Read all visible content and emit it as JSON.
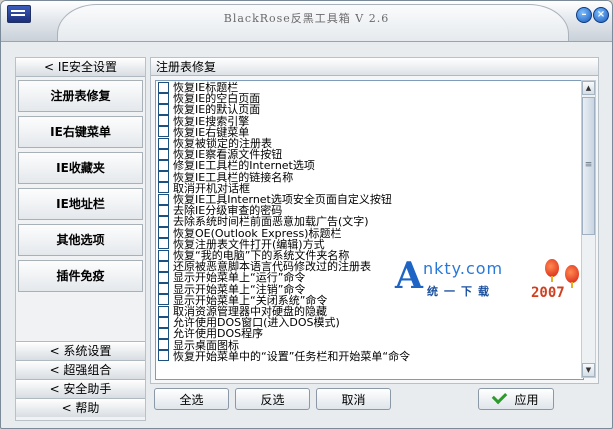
{
  "window": {
    "title": "BlackRose反黑工具箱 V 2.6"
  },
  "sidebar": {
    "header": "<  IE安全设置",
    "items": [
      {
        "label": "注册表修复"
      },
      {
        "label": "IE右键菜单"
      },
      {
        "label": "IE收藏夹"
      },
      {
        "label": "IE地址栏"
      },
      {
        "label": "其他选项"
      },
      {
        "label": "插件免疫"
      }
    ],
    "footer": [
      {
        "label": "<  系统设置"
      },
      {
        "label": "<  超强组合"
      },
      {
        "label": "<  安全助手"
      },
      {
        "label": "<  帮助"
      }
    ]
  },
  "panel": {
    "title": "注册表修复",
    "items": [
      "恢复IE标题栏",
      "恢复IE的空白页面",
      "恢复IE的默认页面",
      "恢复IE搜索引擎",
      "恢复IE右键菜单",
      "恢复被锁定的注册表",
      "恢复IE察看源文件按钮",
      "修复IE工具栏的Internet选项",
      "恢复IE工具栏的链接名称",
      "取消开机对话框",
      "恢复IE工具Internet选项安全页面自定义按钮",
      "去除IE分级审查的密码",
      "去除系统时间栏前面恶意加载广告(文字)",
      "恢复OE(Outlook Express)标题栏",
      "恢复注册表文件打开(编辑)方式",
      "恢复“我的电脑”下的系统文件夹名称",
      "还原被恶意脚本语言代码修改过的注册表",
      "显示开始菜单上“运行”命令",
      "显示开始菜单上“注销”命令",
      "显示开始菜单上“关闭系统”命令",
      "取消资源管理器中对硬盘的隐藏",
      "允许使用DOS窗口(进入DOS模式)",
      "允许使用DOS程序",
      "显示桌面图标",
      "恢复开始菜单中的“设置”任务栏和开始菜单“命令"
    ]
  },
  "watermark": {
    "letter": "A",
    "site": "nkty.com",
    "sub": "统一下载",
    "year": "2007"
  },
  "buttons": {
    "select_all": "全选",
    "invert": "反选",
    "cancel": "取消",
    "apply": "应用"
  },
  "icons": [
    "app-icon",
    "minimize-icon",
    "close-icon",
    "scroll-up-icon",
    "scroll-down-icon",
    "grip-icon",
    "check-icon"
  ]
}
